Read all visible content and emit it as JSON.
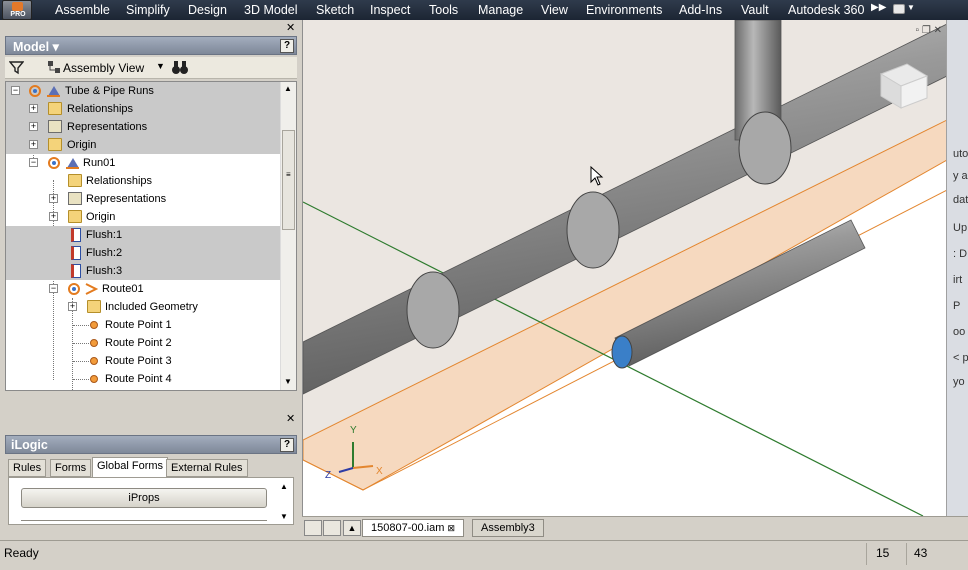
{
  "ribbon": {
    "app_badge": "PRO",
    "tabs": [
      "Assemble",
      "Simplify",
      "Design",
      "3D Model",
      "Sketch",
      "Inspect",
      "Tools",
      "Manage",
      "View",
      "Environments",
      "Add-Ins",
      "Vault",
      "Autodesk 360"
    ]
  },
  "browser": {
    "title": "Model",
    "view_mode": "Assembly View",
    "help": "?",
    "tree": [
      {
        "label": "Tube & Pipe Runs",
        "icon": "tube-pipe-icon",
        "selected": true
      },
      {
        "label": "Relationships",
        "icon": "folder-icon",
        "selected": true
      },
      {
        "label": "Representations",
        "icon": "representations-icon",
        "selected": true
      },
      {
        "label": "Origin",
        "icon": "folder-icon",
        "selected": true
      },
      {
        "label": "Run01",
        "icon": "run-icon",
        "selected": false
      },
      {
        "label": "Relationships",
        "icon": "folder-icon",
        "selected": false
      },
      {
        "label": "Representations",
        "icon": "representations-icon",
        "selected": false
      },
      {
        "label": "Origin",
        "icon": "folder-icon",
        "selected": false
      },
      {
        "label": "Flush:1",
        "icon": "flush-icon",
        "selected": true
      },
      {
        "label": "Flush:2",
        "icon": "flush-icon",
        "selected": true
      },
      {
        "label": "Flush:3",
        "icon": "flush-icon",
        "selected": true
      },
      {
        "label": "Route01",
        "icon": "route-icon",
        "selected": false
      },
      {
        "label": "Included Geometry",
        "icon": "folder-icon",
        "selected": false
      },
      {
        "label": "Route Point 1",
        "icon": "route-point-icon",
        "selected": false
      },
      {
        "label": "Route Point 2",
        "icon": "route-point-icon",
        "selected": false
      },
      {
        "label": "Route Point 3",
        "icon": "route-point-icon",
        "selected": false
      },
      {
        "label": "Route Point 4",
        "icon": "route-point-icon",
        "selected": false
      }
    ]
  },
  "ilogic": {
    "title": "iLogic",
    "help": "?",
    "tabs": [
      "Rules",
      "Forms",
      "Global Forms",
      "External Rules"
    ],
    "active_tab": "Global Forms",
    "form_button": "iProps"
  },
  "viewport": {
    "triad": {
      "x": "X",
      "y": "Y",
      "z": "Z"
    }
  },
  "right_strip_fragments": [
    "uto",
    "y a",
    "dat",
    "Up",
    ": D",
    "irt",
    "P",
    "oo",
    "< p",
    "yo"
  ],
  "doc_tabs": [
    "150807-00.iam",
    "Assembly3"
  ],
  "status": {
    "text": "Ready",
    "num1": "15",
    "num2": "43"
  }
}
